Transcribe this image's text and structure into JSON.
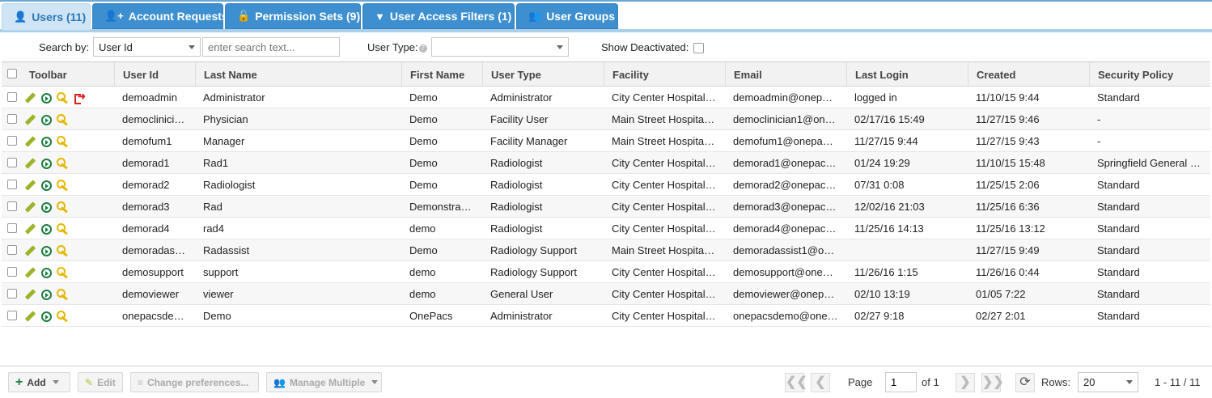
{
  "tabs": [
    {
      "label": "Users (11)",
      "icon": "user-icon",
      "active": true
    },
    {
      "label": "Account Requests",
      "icon": "user-plus-icon"
    },
    {
      "label": "Permission Sets (9)",
      "icon": "unlock-icon"
    },
    {
      "label": "User Access Filters (1)",
      "icon": "filter-icon"
    },
    {
      "label": "User Groups",
      "icon": "users-icon"
    }
  ],
  "search": {
    "search_by_label": "Search by:",
    "search_by_value": "User Id",
    "placeholder": "enter search text...",
    "user_type_label": "User Type:",
    "show_deactivated_label": "Show Deactivated:"
  },
  "columns": [
    "Toolbar",
    "User Id",
    "Last Name",
    "First Name",
    "User Type",
    "Facility",
    "Email",
    "Last Login",
    "Created",
    "Security Policy"
  ],
  "rows": [
    {
      "user_id": "demoadmin",
      "last_name": "Administrator",
      "first_name": "Demo",
      "user_type": "Administrator",
      "facility": "City Center Hospital…",
      "email": "demoadmin@onep…",
      "last_login": "logged in",
      "created": "11/10/15 9:44",
      "policy": "Standard",
      "logout": true
    },
    {
      "user_id": "democlinici…",
      "last_name": "Physician",
      "first_name": "Demo",
      "user_type": "Facility User",
      "facility": "Main Street Hospita…",
      "email": "democlinician1@on…",
      "last_login": "02/17/16 15:49",
      "created": "11/27/15 9:46",
      "policy": "-"
    },
    {
      "user_id": "demofum1",
      "last_name": "Manager",
      "first_name": "Demo",
      "user_type": "Facility Manager",
      "facility": "Main Street Hospita…",
      "email": "demofum1@onepa…",
      "last_login": "11/27/15 9:44",
      "created": "11/27/15 9:43",
      "policy": "-"
    },
    {
      "user_id": "demorad1",
      "last_name": "Rad1",
      "first_name": "Demo",
      "user_type": "Radiologist",
      "facility": "City Center Hospital…",
      "email": "demorad1@onepac…",
      "last_login": "01/24 19:29",
      "created": "11/10/15 15:48",
      "policy": "Springfield General …"
    },
    {
      "user_id": "demorad2",
      "last_name": "Radiologist",
      "first_name": "Demo",
      "user_type": "Radiologist",
      "facility": "City Center Hospital…",
      "email": "demorad2@onepac…",
      "last_login": "07/31 0:08",
      "created": "11/25/15 2:06",
      "policy": "Standard"
    },
    {
      "user_id": "demorad3",
      "last_name": "Rad",
      "first_name": "Demonstra…",
      "user_type": "Radiologist",
      "facility": "City Center Hospital…",
      "email": "demorad3@onepac…",
      "last_login": "12/02/16 21:03",
      "created": "11/25/16 6:36",
      "policy": "Standard"
    },
    {
      "user_id": "demorad4",
      "last_name": "rad4",
      "first_name": "demo",
      "user_type": "Radiologist",
      "facility": "City Center Hospital…",
      "email": "demorad4@onepac…",
      "last_login": "11/25/16 14:13",
      "created": "11/25/16 13:12",
      "policy": "Standard"
    },
    {
      "user_id": "demoradas…",
      "last_name": "Radassist",
      "first_name": "Demo",
      "user_type": "Radiology Support",
      "facility": "Main Street Hospita…",
      "email": "demoradassist1@o…",
      "last_login": "",
      "created": "11/27/15 9:49",
      "policy": "Standard"
    },
    {
      "user_id": "demosupport",
      "last_name": "support",
      "first_name": "demo",
      "user_type": "Radiology Support",
      "facility": "City Center Hospital…",
      "email": "demosupport@one…",
      "last_login": "11/26/16 1:15",
      "created": "11/26/16 0:44",
      "policy": "Standard"
    },
    {
      "user_id": "demoviewer",
      "last_name": "viewer",
      "first_name": "demo",
      "user_type": "General User",
      "facility": "City Center Hospital…",
      "email": "demoviewer@onep…",
      "last_login": "02/10 13:19",
      "created": "01/05 7:22",
      "policy": "Standard"
    },
    {
      "user_id": "onepacsde…",
      "last_name": "Demo",
      "first_name": "OnePacs",
      "user_type": "Administrator",
      "facility": "City Center Hospital…",
      "email": "onepacsdemo@one…",
      "last_login": "02/27 9:18",
      "created": "02/27 2:01",
      "policy": "Standard"
    }
  ],
  "footer": {
    "add_label": "Add",
    "edit_label": "Edit",
    "prefs_label": "Change preferences...",
    "manage_label": "Manage Multiple",
    "page_label": "Page",
    "page_value": "1",
    "of_label": "of 1",
    "rows_label": "Rows:",
    "rows_value": "20",
    "range_text": "1 - 11 / 11"
  }
}
